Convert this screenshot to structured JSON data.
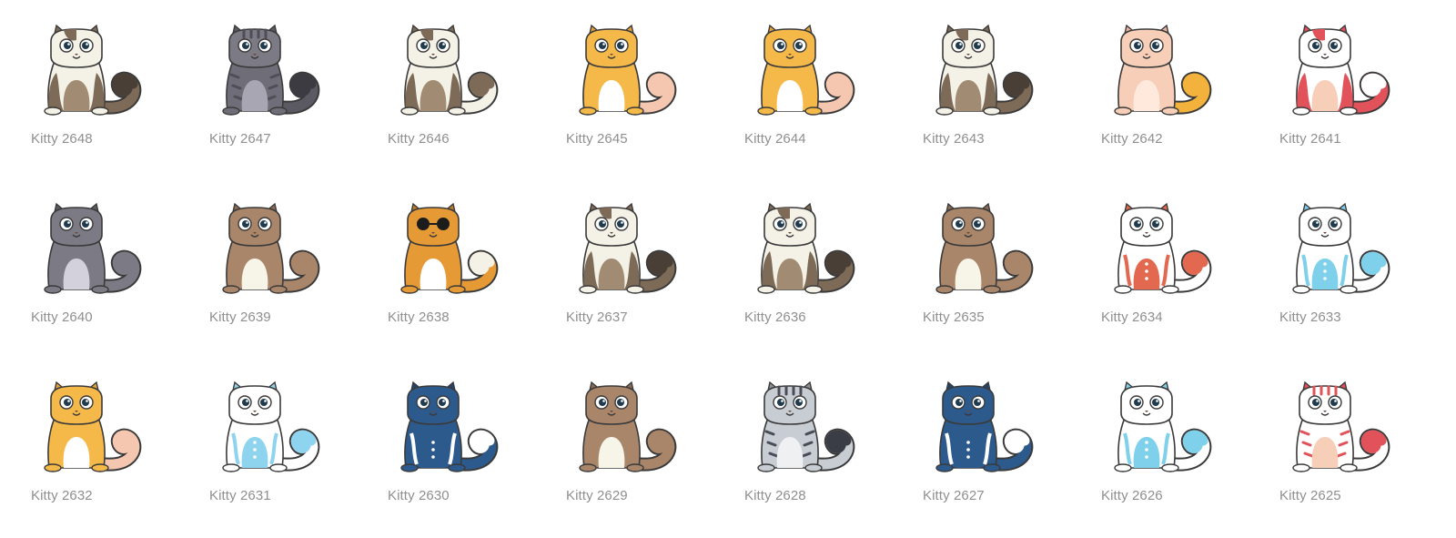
{
  "kitties": [
    {
      "name": "Kitty 2648",
      "body": "#f4f1e7",
      "patch": "#7d6a57",
      "belly": "#a28b73",
      "tail": "#7d6a57",
      "tailTip": "#4a3f36",
      "head": "#f4f1e7",
      "ears": "#7d6a57",
      "pattern": "calico"
    },
    {
      "name": "Kitty 2647",
      "body": "#6f6e78",
      "patch": "#4f4e57",
      "belly": "#a7a6b2",
      "tail": "#5b5a63",
      "tailTip": "#3c3b42",
      "head": "#7b7a85",
      "ears": "#5b5a63",
      "pattern": "stripes"
    },
    {
      "name": "Kitty 2646",
      "body": "#f4f1e7",
      "patch": "#7d6a57",
      "belly": "#a28b73",
      "tail": "#f4f1e7",
      "tailTip": "#7d6a57",
      "head": "#f4f1e7",
      "ears": "#7d6a57",
      "pattern": "calico"
    },
    {
      "name": "Kitty 2645",
      "body": "#f5b94a",
      "patch": "#f5b94a",
      "belly": "#ffffff",
      "tail": "#f5c6b0",
      "tailTip": "#f5c6b0",
      "head": "#f5b94a",
      "ears": "#e0a03a",
      "pattern": "plain"
    },
    {
      "name": "Kitty 2644",
      "body": "#f5b94a",
      "patch": "#f5b94a",
      "belly": "#ffffff",
      "tail": "#f5c6b0",
      "tailTip": "#f5c6b0",
      "head": "#f5b94a",
      "ears": "#e0a03a",
      "pattern": "plain"
    },
    {
      "name": "Kitty 2643",
      "body": "#f4f1e7",
      "patch": "#7d6a57",
      "belly": "#a28b73",
      "tail": "#7d6a57",
      "tailTip": "#4a3f36",
      "head": "#f4f1e7",
      "ears": "#7d6a57",
      "pattern": "calico"
    },
    {
      "name": "Kitty 2642",
      "body": "#f7cfb8",
      "patch": "#f7cfb8",
      "belly": "#ffe8dc",
      "tail": "#f2b23c",
      "tailTip": "#f2b23c",
      "head": "#f7cfb8",
      "ears": "#e8b59c",
      "pattern": "plain"
    },
    {
      "name": "Kitty 2641",
      "body": "#ffffff",
      "patch": "#e2525a",
      "belly": "#f7cfb8",
      "tail": "#e2525a",
      "tailTip": "#ffffff",
      "head": "#ffffff",
      "ears": "#e2525a",
      "pattern": "calico"
    },
    {
      "name": "Kitty 2640",
      "body": "#7b7a85",
      "patch": "#6c6b75",
      "belly": "#d3d2dc",
      "tail": "#7b7a85",
      "tailTip": "#7b7a85",
      "head": "#7b7a85",
      "ears": "#5b5a63",
      "pattern": "plain"
    },
    {
      "name": "Kitty 2639",
      "body": "#a9856a",
      "patch": "#a9856a",
      "belly": "#f7f4e8",
      "tail": "#a9856a",
      "tailTip": "#a9856a",
      "head": "#a9856a",
      "ears": "#8b6b53",
      "pattern": "plain"
    },
    {
      "name": "Kitty 2638",
      "body": "#e59a35",
      "patch": "#f4f1e7",
      "belly": "#ffffff",
      "tail": "#e59a35",
      "tailTip": "#f4f1e7",
      "head": "#e59a35",
      "ears": "#b87a2c",
      "pattern": "shades"
    },
    {
      "name": "Kitty 2637",
      "body": "#f4f1e7",
      "patch": "#7d6a57",
      "belly": "#a28b73",
      "tail": "#7d6a57",
      "tailTip": "#4a3f36",
      "head": "#f4f1e7",
      "ears": "#7d6a57",
      "pattern": "calico"
    },
    {
      "name": "Kitty 2636",
      "body": "#f4f1e7",
      "patch": "#7d6a57",
      "belly": "#a28b73",
      "tail": "#7d6a57",
      "tailTip": "#4a3f36",
      "head": "#f4f1e7",
      "ears": "#7d6a57",
      "pattern": "calico"
    },
    {
      "name": "Kitty 2635",
      "body": "#a9856a",
      "patch": "#a9856a",
      "belly": "#f7f4e8",
      "tail": "#a9856a",
      "tailTip": "#a9856a",
      "head": "#a9856a",
      "ears": "#8b6b53",
      "pattern": "plain"
    },
    {
      "name": "Kitty 2634",
      "body": "#ffffff",
      "patch": "#e2684f",
      "belly": "#e2684f",
      "tail": "#ffffff",
      "tailTip": "#e2684f",
      "head": "#ffffff",
      "ears": "#e2684f",
      "pattern": "tribal"
    },
    {
      "name": "Kitty 2633",
      "body": "#ffffff",
      "patch": "#7fd0ea",
      "belly": "#7fd0ea",
      "tail": "#ffffff",
      "tailTip": "#7fd0ea",
      "head": "#ffffff",
      "ears": "#7fd0ea",
      "pattern": "tribal"
    },
    {
      "name": "Kitty 2632",
      "body": "#f5b94a",
      "patch": "#f5b94a",
      "belly": "#ffffff",
      "tail": "#f5c6b0",
      "tailTip": "#f5c6b0",
      "head": "#f5b94a",
      "ears": "#e0a03a",
      "pattern": "plain"
    },
    {
      "name": "Kitty 2631",
      "body": "#ffffff",
      "patch": "#8fd4ee",
      "belly": "#8fd4ee",
      "tail": "#ffffff",
      "tailTip": "#8fd4ee",
      "head": "#ffffff",
      "ears": "#8fd4ee",
      "pattern": "tribal"
    },
    {
      "name": "Kitty 2630",
      "body": "#2d5a8c",
      "patch": "#ffffff",
      "belly": "#2d5a8c",
      "tail": "#2d5a8c",
      "tailTip": "#ffffff",
      "head": "#2d5a8c",
      "ears": "#1f4470",
      "pattern": "tribal"
    },
    {
      "name": "Kitty 2629",
      "body": "#a9856a",
      "patch": "#a9856a",
      "belly": "#f7f4e8",
      "tail": "#a9856a",
      "tailTip": "#a9856a",
      "head": "#a9856a",
      "ears": "#8b6b53",
      "pattern": "plain"
    },
    {
      "name": "Kitty 2628",
      "body": "#c8ccd3",
      "patch": "#4a4d57",
      "belly": "#eef0f2",
      "tail": "#c8ccd3",
      "tailTip": "#3a3d45",
      "head": "#c8ccd3",
      "ears": "#8d9099",
      "pattern": "stripes"
    },
    {
      "name": "Kitty 2627",
      "body": "#2d5a8c",
      "patch": "#ffffff",
      "belly": "#2d5a8c",
      "tail": "#2d5a8c",
      "tailTip": "#ffffff",
      "head": "#2d5a8c",
      "ears": "#1f4470",
      "pattern": "tribal"
    },
    {
      "name": "Kitty 2626",
      "body": "#ffffff",
      "patch": "#7fd0ea",
      "belly": "#7fd0ea",
      "tail": "#ffffff",
      "tailTip": "#7fd0ea",
      "head": "#ffffff",
      "ears": "#7fd0ea",
      "pattern": "tribal"
    },
    {
      "name": "Kitty 2625",
      "body": "#ffffff",
      "patch": "#e2525a",
      "belly": "#f7cfb8",
      "tail": "#ffffff",
      "tailTip": "#e2525a",
      "head": "#ffffff",
      "ears": "#e2525a",
      "pattern": "stripes"
    }
  ]
}
